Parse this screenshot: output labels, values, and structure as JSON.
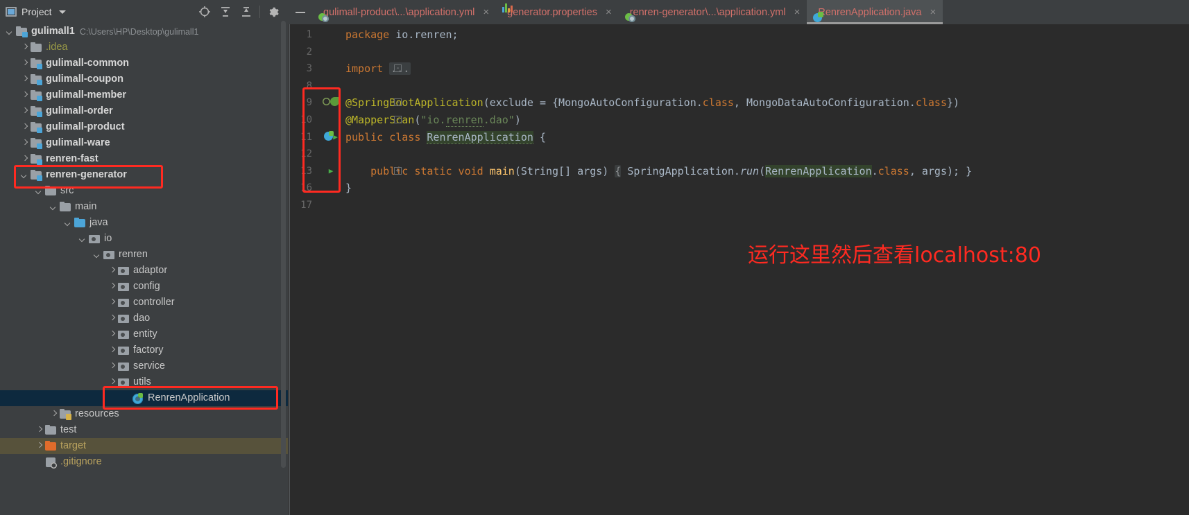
{
  "project_panel": {
    "title": "Project",
    "icons": {
      "panel": "project-panel-icon",
      "dropdown": "chevron-down-icon",
      "locate": "locate-target-icon",
      "expand_all": "expand-all-icon",
      "collapse_all": "collapse-all-icon",
      "settings": "gear-icon"
    },
    "tree": [
      {
        "label": "gulimall1",
        "path": "C:\\Users\\HP\\Desktop\\gulimall1",
        "depth": 0,
        "state": "expanded",
        "icon": "module-folder-icon",
        "bold": true
      },
      {
        "label": ".idea",
        "depth": 1,
        "state": "collapsed",
        "icon": "folder-icon",
        "color": "yellow"
      },
      {
        "label": "gulimall-common",
        "depth": 1,
        "state": "collapsed",
        "icon": "module-folder-icon",
        "bold": true
      },
      {
        "label": "gulimall-coupon",
        "depth": 1,
        "state": "collapsed",
        "icon": "module-folder-icon",
        "bold": true
      },
      {
        "label": "gulimall-member",
        "depth": 1,
        "state": "collapsed",
        "icon": "module-folder-icon",
        "bold": true
      },
      {
        "label": "gulimall-order",
        "depth": 1,
        "state": "collapsed",
        "icon": "module-folder-icon",
        "bold": true
      },
      {
        "label": "gulimall-product",
        "depth": 1,
        "state": "collapsed",
        "icon": "module-folder-icon",
        "bold": true
      },
      {
        "label": "gulimall-ware",
        "depth": 1,
        "state": "collapsed",
        "icon": "module-folder-icon",
        "bold": true
      },
      {
        "label": "renren-fast",
        "depth": 1,
        "state": "collapsed",
        "icon": "module-folder-icon",
        "bold": true
      },
      {
        "label": "renren-generator",
        "depth": 1,
        "state": "expanded",
        "icon": "module-folder-icon",
        "bold": true,
        "highlight": "red-box"
      },
      {
        "label": "src",
        "depth": 2,
        "state": "expanded",
        "icon": "folder-icon"
      },
      {
        "label": "main",
        "depth": 3,
        "state": "expanded",
        "icon": "folder-icon"
      },
      {
        "label": "java",
        "depth": 4,
        "state": "expanded",
        "icon": "source-folder-icon"
      },
      {
        "label": "io",
        "depth": 5,
        "state": "expanded",
        "icon": "package-icon"
      },
      {
        "label": "renren",
        "depth": 6,
        "state": "expanded",
        "icon": "package-icon"
      },
      {
        "label": "adaptor",
        "depth": 7,
        "state": "collapsed",
        "icon": "package-icon"
      },
      {
        "label": "config",
        "depth": 7,
        "state": "collapsed",
        "icon": "package-icon"
      },
      {
        "label": "controller",
        "depth": 7,
        "state": "collapsed",
        "icon": "package-icon"
      },
      {
        "label": "dao",
        "depth": 7,
        "state": "collapsed",
        "icon": "package-icon"
      },
      {
        "label": "entity",
        "depth": 7,
        "state": "collapsed",
        "icon": "package-icon"
      },
      {
        "label": "factory",
        "depth": 7,
        "state": "collapsed",
        "icon": "package-icon"
      },
      {
        "label": "service",
        "depth": 7,
        "state": "collapsed",
        "icon": "package-icon"
      },
      {
        "label": "utils",
        "depth": 7,
        "state": "collapsed",
        "icon": "package-icon"
      },
      {
        "label": "RenrenApplication",
        "depth": 8,
        "state": "leaf",
        "icon": "spring-class-icon",
        "selected": true,
        "highlight": "red-box"
      },
      {
        "label": "resources",
        "depth": 3,
        "state": "collapsed",
        "icon": "resources-folder-icon"
      },
      {
        "label": "test",
        "depth": 2,
        "state": "collapsed",
        "icon": "folder-icon"
      },
      {
        "label": "target",
        "depth": 2,
        "state": "collapsed",
        "icon": "excluded-folder-icon",
        "color": "orange",
        "row_highlight": true
      },
      {
        "label": ".gitignore",
        "depth": 2,
        "state": "leaf",
        "icon": "gitignore-icon",
        "color": "orange"
      }
    ]
  },
  "editor_tabs": {
    "minimize_label": "—",
    "items": [
      {
        "label": "gulimall-product\\...\\application.yml",
        "icon": "yaml-file-icon",
        "active": false,
        "close": "×"
      },
      {
        "label": "generator.properties",
        "icon": "properties-file-icon",
        "active": false,
        "close": "×"
      },
      {
        "label": "renren-generator\\...\\application.yml",
        "icon": "yaml-file-icon",
        "active": false,
        "close": "×"
      },
      {
        "label": "RenrenApplication.java",
        "icon": "java-class-icon",
        "active": true,
        "close": "×"
      }
    ]
  },
  "editor": {
    "file": "RenrenApplication.java",
    "lines": [
      {
        "num": "1",
        "text": "package io.renren;"
      },
      {
        "num": "2",
        "text": ""
      },
      {
        "num": "3",
        "text": "import ...",
        "folded": true
      },
      {
        "num": "8",
        "text": ""
      },
      {
        "num": "9",
        "text": "@SpringBootApplication(exclude = {MongoAutoConfiguration.class, MongoDataAutoConfiguration.class})",
        "gutter": "inspection-and-leaf-icons"
      },
      {
        "num": "10",
        "text": "@MapperScan(\"io.renren.dao\")"
      },
      {
        "num": "11",
        "text": "public class RenrenApplication {",
        "gutter": "spring-and-run-icons"
      },
      {
        "num": "12",
        "text": ""
      },
      {
        "num": "13",
        "text": "    public static void main(String[] args) { SpringApplication.run(RenrenApplication.class, args); }",
        "gutter": "run-icon"
      },
      {
        "num": "16",
        "text": "}"
      },
      {
        "num": "17",
        "text": ""
      }
    ],
    "gutter_highlight": "red-box"
  },
  "annotation": {
    "text": "运行这里然后查看localhost:80",
    "color": "#ff2a21"
  },
  "colors": {
    "panel_bg": "#3c3f41",
    "editor_bg": "#2b2b2b",
    "selection": "#0d293e",
    "tab_active": "#4e5254",
    "annotation_red": "#ff2a21",
    "tab_text": "#d2706a",
    "keyword": "#cc7832",
    "annotation_kw": "#bbb529",
    "string": "#6a8759",
    "method": "#ffc66d"
  }
}
